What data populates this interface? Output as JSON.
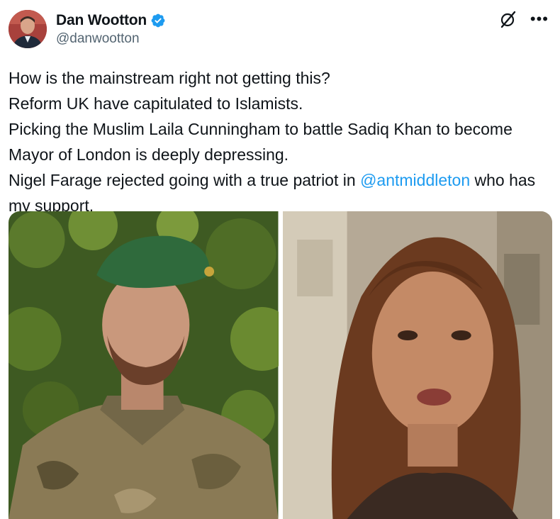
{
  "tweet": {
    "author": {
      "display_name": "Dan Wootton",
      "handle": "@danwootton",
      "verified": true
    },
    "body": [
      [
        {
          "text": "How is the mainstream right not getting this?"
        }
      ],
      [
        {
          "text": "Reform UK have capitulated to Islamists."
        }
      ],
      [
        {
          "text": "Picking the Muslim Laila Cunningham to battle Sadiq Khan to become"
        }
      ],
      [
        {
          "text": "Mayor of London is deeply depressing."
        }
      ],
      [
        {
          "text": "Nigel Farage rejected going with a true patriot in "
        },
        {
          "text": "@antmiddleton",
          "mention": true
        },
        {
          "text": " who has"
        }
      ],
      [
        {
          "text": "my support."
        }
      ]
    ],
    "media": [
      {
        "icon": "man-in-green-beret-camouflage-photo"
      },
      {
        "icon": "woman-speaking-photo"
      }
    ]
  },
  "colors": {
    "text": "#0f1419",
    "secondary": "#536471",
    "link": "#1d9bf0",
    "verified": "#1d9bf0"
  }
}
